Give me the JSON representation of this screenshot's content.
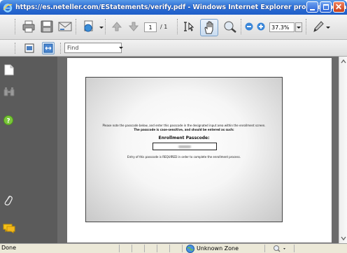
{
  "window": {
    "title": "https://es.neteller.com/EStatements/verify.pdf - Windows Internet Explorer provided by Jack..."
  },
  "toolbar": {
    "current_page": "1",
    "page_total": "/ 1",
    "zoom": "37.3%",
    "find_placeholder": "Find"
  },
  "document": {
    "instruction_line1": "Please note the passcode below, and enter this passcode in the designated input area within the enrollment screen.",
    "instruction_line2": "The passcode is case-sensitive, and should be entered as such:",
    "passcode_heading": "Enrollment Passcode:",
    "footer_note": "Entry of this passcode is REQUIRED in order to complete the enrollment process."
  },
  "statusbar": {
    "status": "Done",
    "zone": "Unknown Zone"
  },
  "colors": {
    "titlebar": "#2d6fd6",
    "sidebar": "#5b5b5b",
    "viewer_bg": "#6b6b6b"
  }
}
